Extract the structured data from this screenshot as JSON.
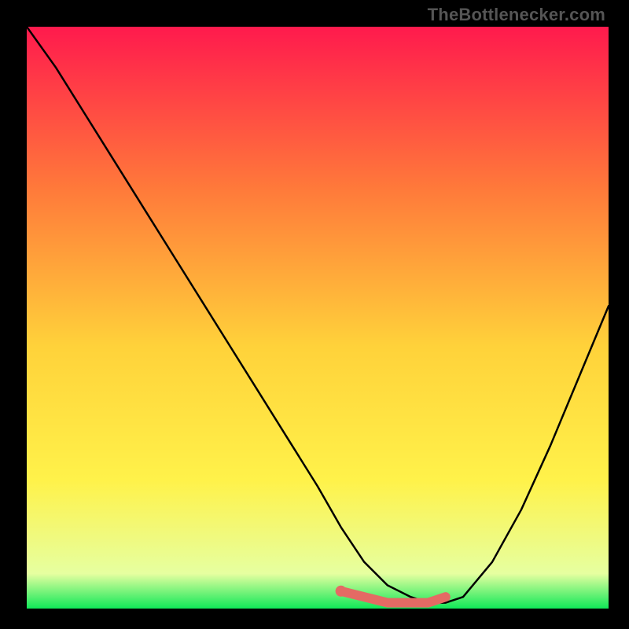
{
  "watermark": "TheBottlenecker.com",
  "colors": {
    "gradient_top": "#ff1a4d",
    "gradient_mid1": "#ff7a3a",
    "gradient_mid2": "#ffd23a",
    "gradient_mid3": "#fff24a",
    "gradient_low": "#e6ffa0",
    "gradient_bottom": "#10e858",
    "curve": "#000000",
    "marker": "#e46a64",
    "frame": "#000000"
  },
  "chart_data": {
    "type": "line",
    "title": "",
    "xlabel": "",
    "ylabel": "",
    "xlim": [
      0,
      100
    ],
    "ylim": [
      0,
      100
    ],
    "grid": false,
    "legend": false,
    "series": [
      {
        "name": "bottleneck-curve",
        "x": [
          0,
          5,
          10,
          15,
          20,
          25,
          30,
          35,
          40,
          45,
          50,
          54,
          58,
          62,
          66,
          69,
          72,
          75,
          80,
          85,
          90,
          95,
          100
        ],
        "values": [
          100,
          93,
          85,
          77,
          69,
          61,
          53,
          45,
          37,
          29,
          21,
          14,
          8,
          4,
          2,
          1,
          1,
          2,
          8,
          17,
          28,
          40,
          52
        ]
      }
    ],
    "highlight": {
      "name": "optimal-range",
      "x": [
        54,
        58,
        62,
        66,
        69,
        72
      ],
      "values": [
        3,
        2,
        1,
        1,
        1,
        2
      ]
    },
    "annotations": [
      {
        "text": "TheBottlenecker.com",
        "position": "top-right"
      }
    ]
  }
}
